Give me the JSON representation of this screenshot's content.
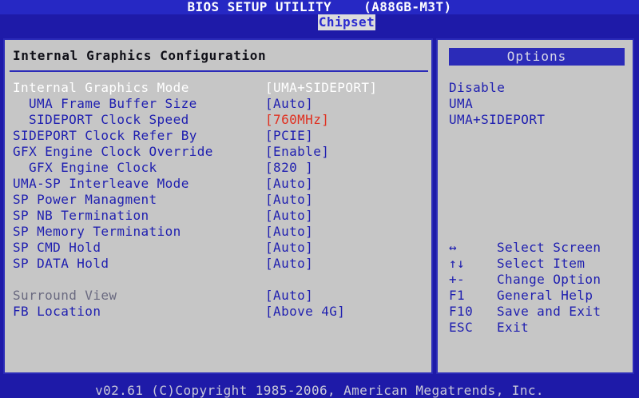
{
  "header": {
    "title": "BIOS SETUP UTILITY    (A88GB-M3T)",
    "active_tab": "Chipset"
  },
  "main": {
    "section_title": "Internal Graphics Configuration",
    "settings": [
      {
        "label": "Internal Graphics Mode",
        "value": "[UMA+SIDEPORT]"
      },
      {
        "label": "UMA Frame Buffer Size",
        "value": "[Auto]"
      },
      {
        "label": "SIDEPORT Clock Speed",
        "value": "[760MHz]"
      },
      {
        "label": "SIDEPORT Clock Refer By",
        "value": "[PCIE]"
      },
      {
        "label": "GFX Engine Clock Override",
        "value": "[Enable]"
      },
      {
        "label": "GFX Engine Clock",
        "value": "[820 ]"
      },
      {
        "label": "UMA-SP Interleave Mode",
        "value": "[Auto]"
      },
      {
        "label": "SP Power Managment",
        "value": "[Auto]"
      },
      {
        "label": "SP NB Termination",
        "value": "[Auto]"
      },
      {
        "label": "SP Memory Termination",
        "value": "[Auto]"
      },
      {
        "label": "SP CMD Hold",
        "value": "[Auto]"
      },
      {
        "label": "SP DATA Hold",
        "value": "[Auto]"
      },
      {
        "label": "Surround View",
        "value": "[Auto]"
      },
      {
        "label": "FB Location",
        "value": "[Above 4G]"
      }
    ]
  },
  "sidebar": {
    "options_title": "Options",
    "options": [
      "Disable",
      "UMA",
      "UMA+SIDEPORT"
    ],
    "help": [
      {
        "key": "↔",
        "desc": "Select Screen"
      },
      {
        "key": "↑↓",
        "desc": "Select Item"
      },
      {
        "key": "+-",
        "desc": "Change Option"
      },
      {
        "key": "F1",
        "desc": "General Help"
      },
      {
        "key": "F10",
        "desc": "Save and Exit"
      },
      {
        "key": "ESC",
        "desc": "Exit"
      }
    ]
  },
  "footer": {
    "text": "v02.61 (C)Copyright 1985-2006, American Megatrends, Inc."
  }
}
